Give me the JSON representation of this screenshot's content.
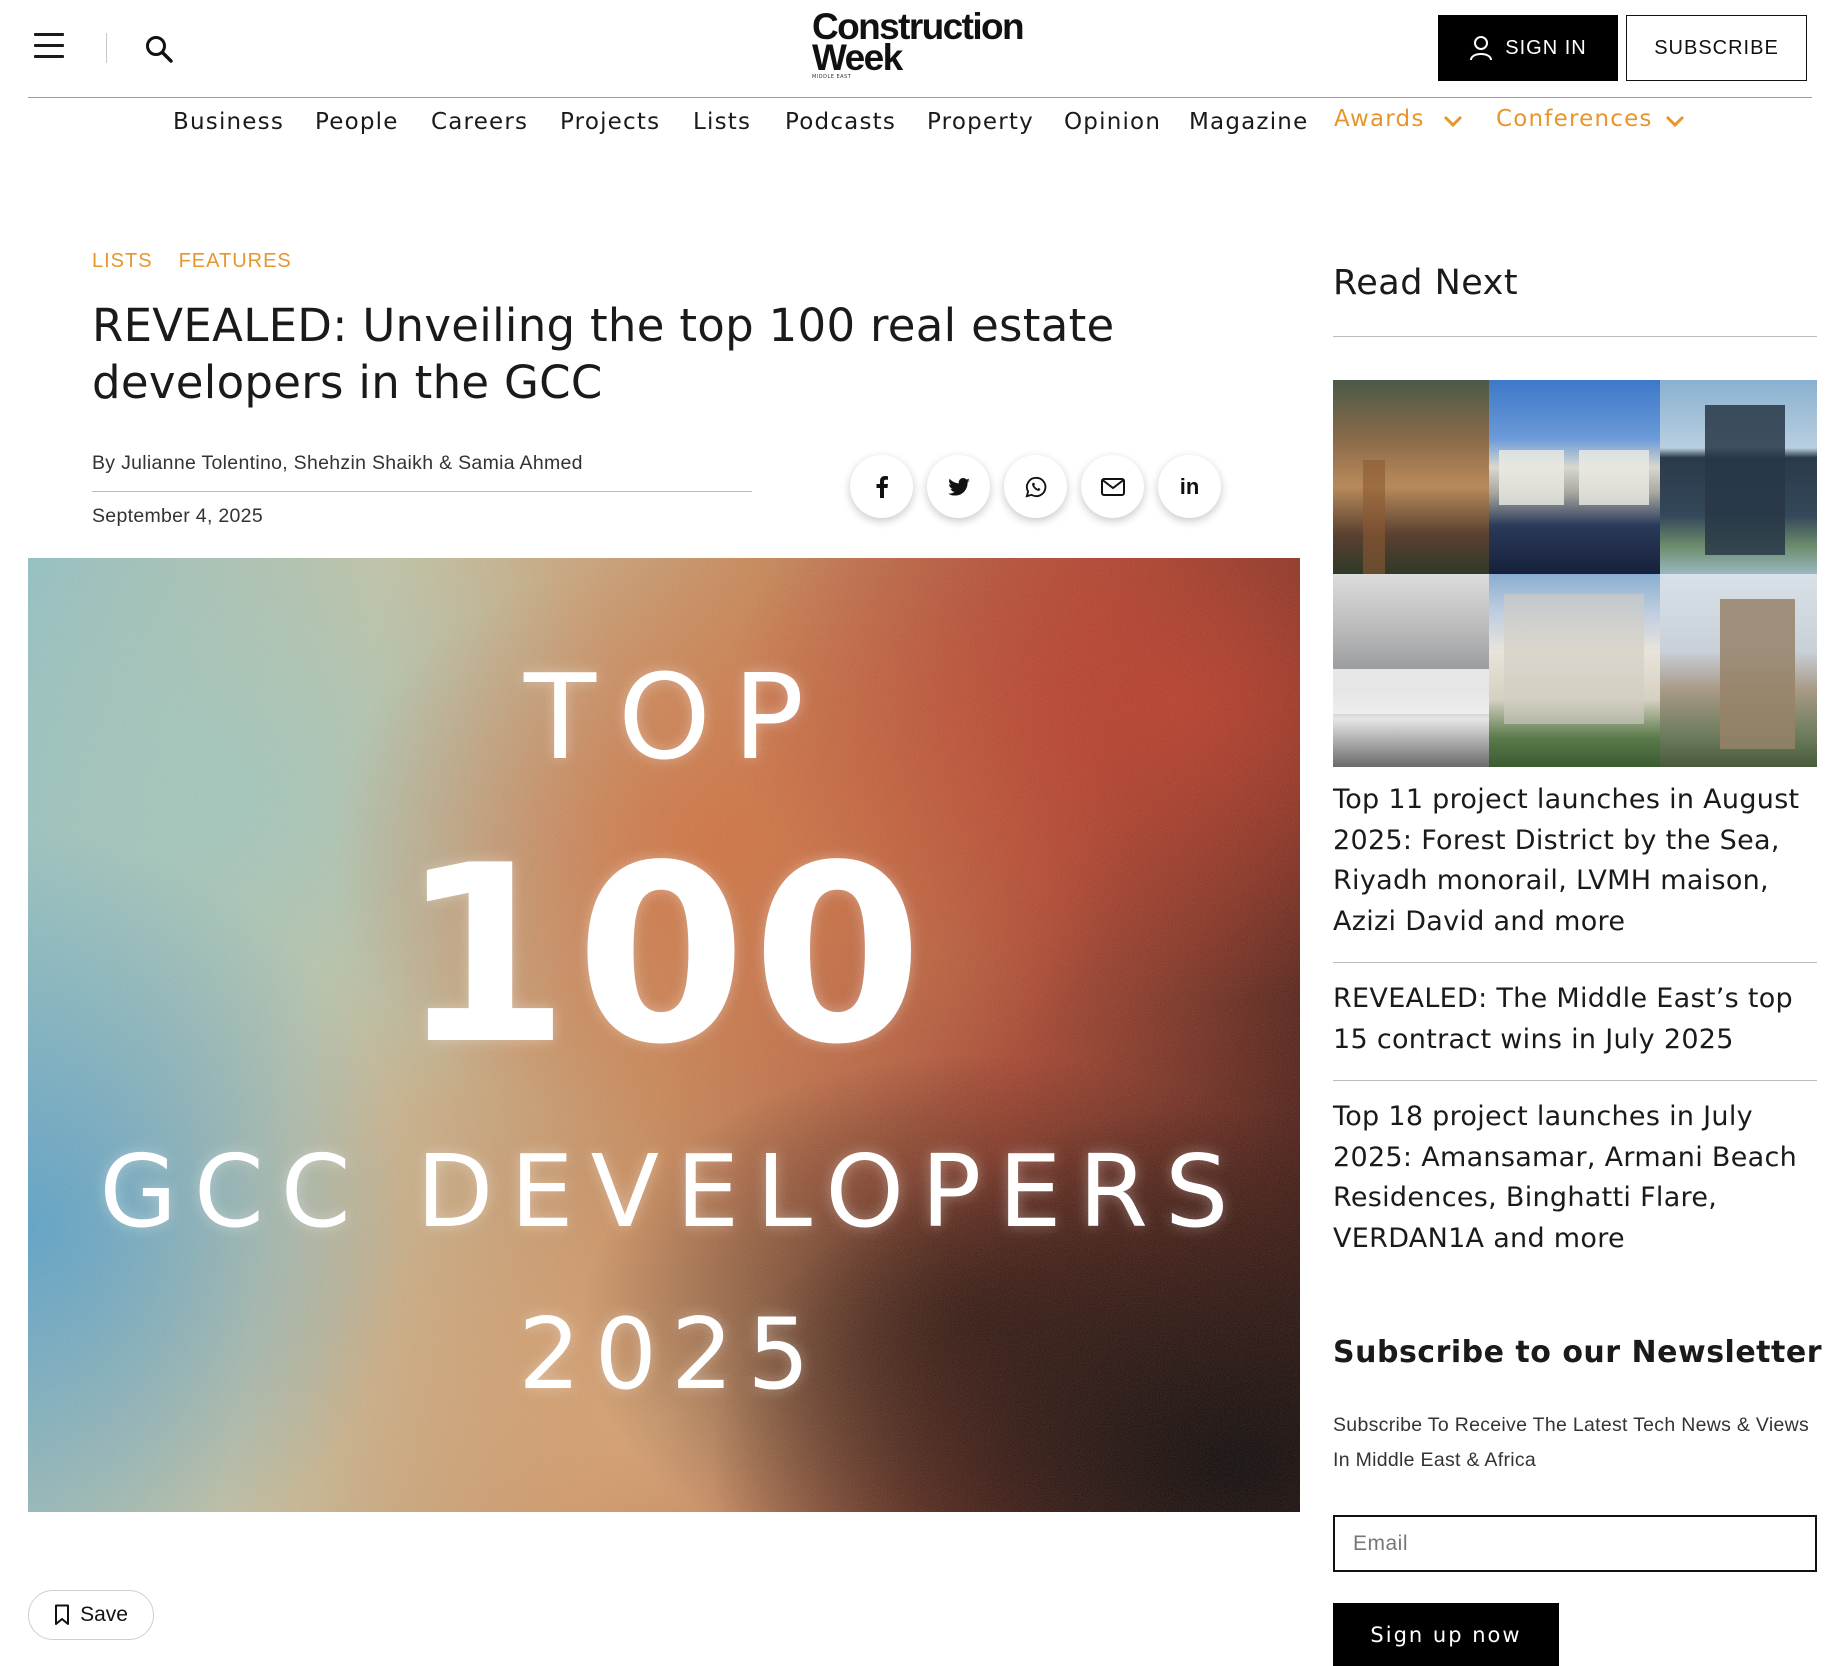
{
  "header": {
    "logo": {
      "line1": "Construction",
      "line2": "Week",
      "line3": "MIDDLE EAST"
    },
    "sign_in_label": "SIGN IN",
    "subscribe_label": "SUBSCRIBE"
  },
  "nav": {
    "items": [
      "Business",
      "People",
      "Careers",
      "Projects",
      "Lists",
      "Podcasts",
      "Property",
      "Opinion",
      "Magazine"
    ],
    "dropdowns": [
      "Awards",
      "Conferences"
    ],
    "accent_color": "#e8952b"
  },
  "article": {
    "categories": [
      "LISTS",
      "FEATURES"
    ],
    "title": "REVEALED: Unveiling the top 100 real estate developers in the GCC",
    "byline": "By Julianne Tolentino, Shehzin Shaikh & Samia Ahmed",
    "date": "September 4, 2025",
    "share_icons": [
      "facebook-icon",
      "twitter-icon",
      "whatsapp-icon",
      "email-icon",
      "linkedin-icon"
    ],
    "hero": {
      "line1": "TOP",
      "line2": "100",
      "line3": "GCC DEVELOPERS",
      "line4": "2025"
    },
    "save_label": "Save"
  },
  "sidebar": {
    "read_next_title": "Read Next",
    "items": [
      "Top 11 project launches in August 2025: Forest District by the Sea, Riyadh monorail, LVMH maison, Azizi David and more",
      "REVEALED: The Middle East’s top 15 contract wins in July 2025",
      "Top 18 project launches in July 2025: Amansamar, Armani Beach Residences, Binghatti Flare, VERDAN1A and more"
    ],
    "newsletter": {
      "title": "Subscribe to our Newsletter",
      "description": "Subscribe To Receive The Latest Tech News & Views In Middle East & Africa",
      "email_placeholder": "Email",
      "button_label": "Sign up now"
    }
  }
}
